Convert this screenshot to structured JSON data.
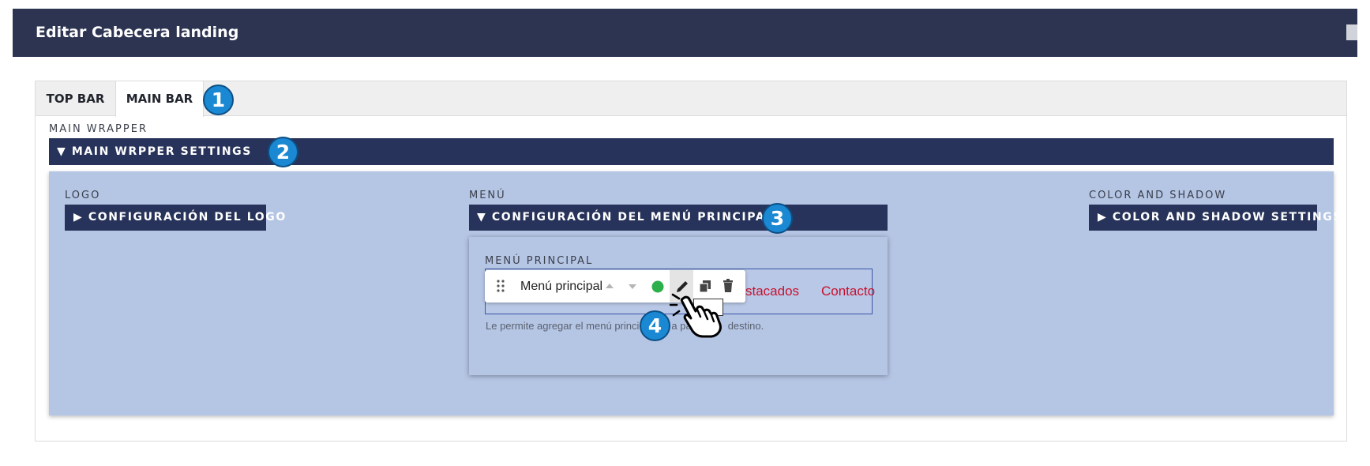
{
  "header": {
    "title": "Editar Cabecera landing"
  },
  "tabs": [
    {
      "label": "TOP BAR",
      "active": false
    },
    {
      "label": "MAIN BAR",
      "active": true
    }
  ],
  "badges": [
    "1",
    "2",
    "3",
    "4"
  ],
  "main_wrapper": {
    "label": "MAIN WRAPPER",
    "settings_label": "▼ MAIN WRPPER SETTINGS"
  },
  "logo": {
    "label": "LOGO",
    "settings_label": "▶ CONFIGURACIÓN DEL LOGO"
  },
  "menu": {
    "label": "MENÚ",
    "settings_label": "▼ CONFIGURACIÓN DEL MENÚ PRINCIPAL",
    "field_label": "MENÚ PRINCIPAL",
    "toolbar_label": "Menú principal",
    "preview_links": [
      "stacados",
      "Contacto"
    ],
    "help_text_start": "Le permite agregar el menú princi",
    "help_text_mid": "a pa",
    "help_text_end": "destino.",
    "status_color": "#2db04b",
    "link_color": "#c8102e"
  },
  "color_shadow": {
    "label": "COLOR AND SHADOW",
    "settings_label": "▶ COLOR AND SHADOW SETTINGS"
  },
  "colors": {
    "header": "#2d3452",
    "dark_bar": "#27335a",
    "wrapper_bg": "#b5c5e4",
    "badge": "#1a88d2"
  },
  "icons": [
    "drag-handle-icon",
    "arrow-up-icon",
    "arrow-down-icon",
    "status-dot-icon",
    "edit-pencil-icon",
    "duplicate-icon",
    "trash-icon",
    "hand-pointer-icon"
  ]
}
